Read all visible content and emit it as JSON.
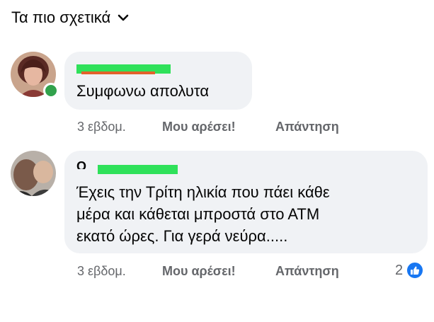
{
  "sort": {
    "label": "Τα πιο σχετικά",
    "icon": "chevron-down-icon"
  },
  "colors": {
    "bubble": "#f0f2f5",
    "redaction": "#2fe15a",
    "online": "#31a24c",
    "like_blue": "#1877f2",
    "meta_text": "#65676b"
  },
  "comments": [
    {
      "author_redacted": true,
      "text": "Συμφωνω απολυτα",
      "time": "3 εβδομ.",
      "like_label": "Μου αρέσει!",
      "reply_label": "Απάντηση",
      "online": true
    },
    {
      "author_visible_fragment": "Ο ... Ρ",
      "author_redacted": true,
      "text": "Έχεις την Τρίτη ηλικία που πάει κάθε\nμέρα και κάθεται μπροστά στο ΑΤΜ\nεκατό ώρες. Για γερά νεύρα.....",
      "time": "3 εβδομ.",
      "like_label": "Μου αρέσει!",
      "reply_label": "Απάντηση",
      "reaction_count": "2",
      "reaction_icon": "thumbs-up-icon"
    }
  ]
}
